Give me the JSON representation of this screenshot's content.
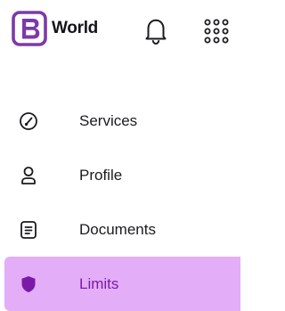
{
  "header": {
    "brand_name": "World",
    "logo_letter": "B",
    "icons": {
      "logo": "b-logo-icon",
      "notifications": "bell-icon",
      "apps": "apps-grid-icon"
    }
  },
  "nav": {
    "items": [
      {
        "label": "Services",
        "icon": "gauge-icon"
      },
      {
        "label": "Profile",
        "icon": "user-icon"
      },
      {
        "label": "Documents",
        "icon": "document-icon"
      },
      {
        "label": "Limits",
        "icon": "shield-icon",
        "active": true
      }
    ]
  },
  "colors": {
    "brand": "#7c3aa8",
    "active_bg": "#e3adf7",
    "active_text": "#7c1aa8",
    "text": "#1b1b1f"
  }
}
